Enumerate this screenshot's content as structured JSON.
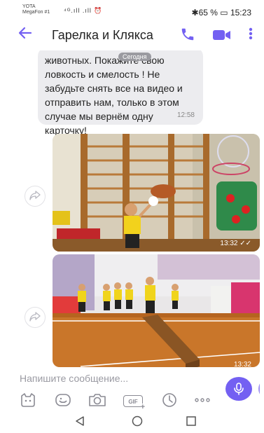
{
  "status_bar": {
    "carrier_line1": "YOTA",
    "carrier_line2": "MegaFon #1",
    "signal_text": "⁴ᴳ.ıll .ıll ⏰",
    "right_text": "✱65 % ▭ 15:23"
  },
  "header": {
    "title": "Гарелка и Клякса",
    "back_icon": "arrow-back-icon",
    "call_icon": "phone-icon",
    "video_icon": "video-call-icon",
    "more_icon": "more-vertical-icon",
    "accent_color": "#7360f2"
  },
  "messages": {
    "text_message": {
      "text": "животных. Покажите свою\nловкость и смелость ! Не\nзабудьте снять все на видео и\nотправить нам, только в этом\nслучае мы вернём одну\nкарточку!",
      "time": "12:58"
    },
    "date_chip": "Сегодня",
    "photo1": {
      "time": "13:32",
      "status_icon": "double-check-icon"
    },
    "photo2": {
      "time": "13:32"
    }
  },
  "composer": {
    "placeholder": "Напишите сообщение...",
    "tools": [
      "sticker-icon",
      "emoji-icon",
      "camera-icon",
      "gif-icon",
      "clock-icon",
      "more-horizontal-icon"
    ],
    "gif_label": "GIF",
    "gif_plus": "+",
    "mic_icon": "microphone-icon"
  },
  "nav_bar": {
    "icons": [
      "back-triangle-icon",
      "home-circle-icon",
      "recents-square-icon"
    ]
  }
}
